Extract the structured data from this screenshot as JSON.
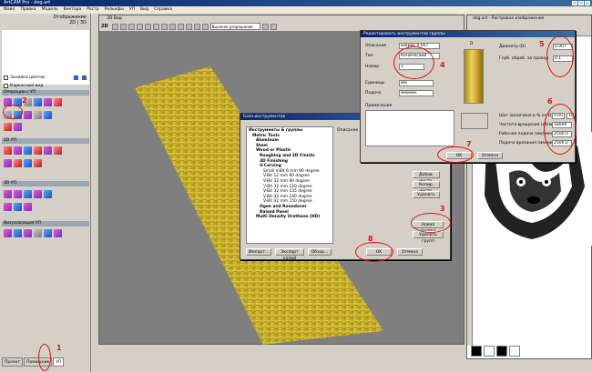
{
  "app": {
    "title": "ArtCAM Pro - dog.art"
  },
  "menu": [
    "Файл",
    "Правка",
    "Модель",
    "Вектора",
    "Растр",
    "Рельефы",
    "УП",
    "Вид",
    "Справка"
  ],
  "left_panel": {
    "header_line1": "Отображение",
    "header_line2": "2D | 3D",
    "fill_color_label": "Заливка цветом",
    "wireframe_label": "Каркасный вид",
    "section_3d_ops": "Операции с УП",
    "section_2d": "2D УП",
    "section_3d": "3D УП",
    "section_vis": "Визуализация УП",
    "tabs": [
      "Проект",
      "Помощник",
      "УП"
    ]
  },
  "view3d": {
    "title": "3D Вид",
    "mode": "2D",
    "quality": "Высокое разрешение"
  },
  "view2d": {
    "title": "dog.art - Растровое изображение"
  },
  "edit_group_dialog": {
    "title": "Редактировать инструментов группы",
    "desc_label": "Описание",
    "desc_value": "Шарик 0,007",
    "type_label": "Тип",
    "type_value": "Конический",
    "number_label": "Номер",
    "number_value": "1",
    "units_label": "Единицы",
    "units_value": "мм",
    "feed_label": "Подача",
    "feed_value": "мм/мин",
    "notes_label": "Примечания",
    "d_label": "D",
    "diameter_label": "Диаметр (D)",
    "diameter_value": "0.007",
    "depth_label": "Глуб. обраб. за проход",
    "depth_value": "0.1",
    "stepover_label": "Шаг (величина в % от D)",
    "stepover_value": "0.007",
    "stepover_pct": "100",
    "spindle_label": "Частота вращения (об/мин)",
    "spindle_value": "18000",
    "feedrate_label": "Рабочая подача (мм/мин)",
    "feedrate_value": "2500.0",
    "plunge_label": "Подача врезания (мм/мин)",
    "plunge_value": "2500.0",
    "ok": "OK",
    "cancel": "Отмена"
  },
  "tool_db_dialog": {
    "title": "База инструментов",
    "group_header": "Инструменты & группы",
    "desc_hint": "Описание н...",
    "tree": [
      {
        "text": "Инструменты & группы",
        "level": 0,
        "bold": true
      },
      {
        "text": "Metric Tools",
        "level": 1,
        "bold": true
      },
      {
        "text": "Aluminum",
        "level": 2,
        "bold": true
      },
      {
        "text": "Steel",
        "level": 2,
        "bold": true
      },
      {
        "text": "Wood or Plastic",
        "level": 2,
        "bold": true
      },
      {
        "text": "Roughing and 2D Finishi",
        "level": 3,
        "bold": true
      },
      {
        "text": "3D Finishing",
        "level": 3,
        "bold": true
      },
      {
        "text": "V-Carving",
        "level": 3,
        "bold": true
      },
      {
        "text": "Small V-Bit 6 mm 90 degree",
        "level": 4,
        "bold": false
      },
      {
        "text": "V-Bit 12 mm 60 degree",
        "level": 4,
        "bold": false
      },
      {
        "text": "V-Bit 32 mm 90 degree",
        "level": 4,
        "bold": false
      },
      {
        "text": "V-Bit 32 mm 120 degree",
        "level": 4,
        "bold": false
      },
      {
        "text": "V-Bit 32 mm 135 degree",
        "level": 4,
        "bold": false
      },
      {
        "text": "V-Bit 32 mm 140 degree",
        "level": 4,
        "bold": false
      },
      {
        "text": "V-Bit 32 mm 150 degree",
        "level": 4,
        "bold": false
      },
      {
        "text": "Ogee and Roundover",
        "level": 3,
        "bold": true
      },
      {
        "text": "Raised Panel",
        "level": 3,
        "bold": true
      },
      {
        "text": "Multi Density Urethane (HD)",
        "level": 2,
        "bold": true
      }
    ],
    "buttons_right": [
      "Добав. инстр.",
      "Копир. инстр.",
      "Удалить"
    ],
    "new_group": "Новая группа",
    "delete_group": "Удалить групп",
    "import": "Импорт...",
    "export": "Экспорт копий",
    "browse": "Обзор...",
    "ok": "OK",
    "cancel": "Отмена"
  },
  "annotations": [
    "1",
    "2",
    "3",
    "4",
    "5",
    "6",
    "7",
    "8"
  ],
  "colors": {
    "accent": "#0a246a",
    "annotation": "#e01010",
    "relief": "#d8c23a"
  }
}
